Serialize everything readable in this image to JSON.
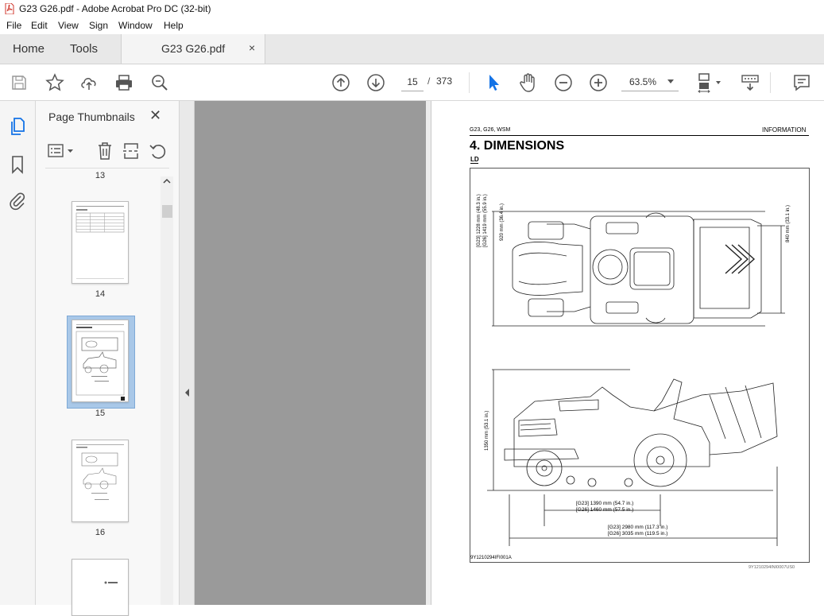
{
  "window": {
    "title": "G23 G26.pdf - Adobe Acrobat Pro DC (32-bit)"
  },
  "menu": [
    "File",
    "Edit",
    "View",
    "Sign",
    "Window",
    "Help"
  ],
  "tabs": {
    "home": "Home",
    "tools": "Tools",
    "document": "G23 G26.pdf",
    "close": "×"
  },
  "toolbar": {
    "current_page": "15",
    "separator": "/",
    "total_pages": "373",
    "zoom": "63.5%"
  },
  "thumbnails": {
    "title": "Page Thumbnails",
    "close": "✕",
    "pages": [
      {
        "label": "13"
      },
      {
        "label": "14"
      },
      {
        "label": "15",
        "selected": true
      },
      {
        "label": "16"
      }
    ]
  },
  "page": {
    "header_left": "G23, G26, WSM",
    "header_right": "INFORMATION",
    "heading": "4.  DIMENSIONS",
    "subheading": "LD",
    "dim_top_left_1": "[G23] 1228 mm (48.3 in.)",
    "dim_top_left_2": "[G26] 1419 mm (55.9 in.)",
    "dim_top_left_3": "920 mm (36.4 in.)",
    "dim_top_right": "840 mm (33.1 in.)",
    "dim_height": "1350 mm (53.1 in.)",
    "dim_wheelbase_1": "[G23] 1390 mm (54.7 in.)",
    "dim_wheelbase_2": "[G26] 1460 mm (57.5 in.)",
    "dim_length_1": "[G23] 2980 mm (117.3 in.)",
    "dim_length_2": "[G26] 3035 mm (119.5 in.)",
    "figure_code": "9Y1210294IFI001A",
    "footer_code": "9Y1210294INI0007US0"
  },
  "colors": {
    "pdf_red": "#d0362b",
    "selected_thumb": "#a9c8e8",
    "select_tool": "#1473e6"
  }
}
